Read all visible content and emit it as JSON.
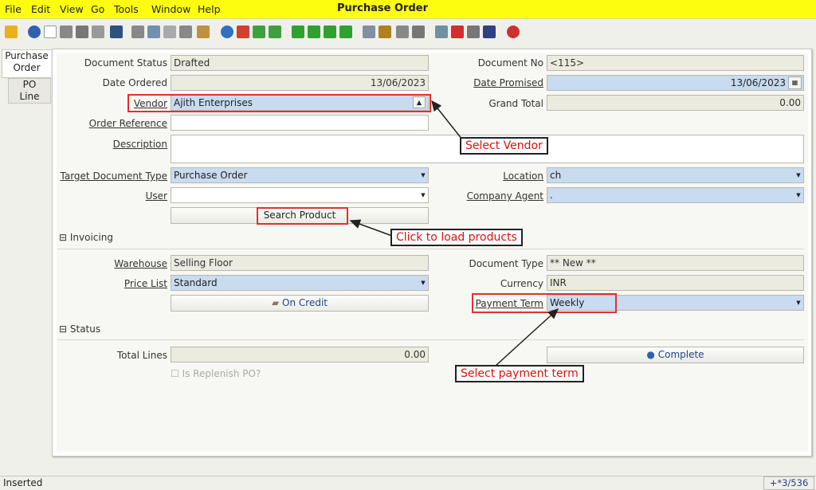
{
  "menu": {
    "file": "File",
    "edit": "Edit",
    "view": "View",
    "go": "Go",
    "tools": "Tools",
    "window": "Window",
    "help": "Help",
    "title": "Purchase Order"
  },
  "tabs": {
    "t1a": "Purchase",
    "t1b": "Order",
    "t2a": "PO",
    "t2b": "Line"
  },
  "form": {
    "document_status_label": "Document Status",
    "document_status": "Drafted",
    "document_no_label": "Document No",
    "document_no": "<115>",
    "date_ordered_label": "Date Ordered",
    "date_ordered": "13/06/2023",
    "date_promised_label": "Date Promised",
    "date_promised": "13/06/2023",
    "vendor_label": "Vendor",
    "vendor": "Ajith Enterprises",
    "grand_total_label": "Grand Total",
    "grand_total": "0.00",
    "order_ref_label": "Order Reference",
    "order_ref": "",
    "description_label": "Description",
    "description": "",
    "target_doc_label": "Target Document Type",
    "target_doc": "Purchase Order",
    "location_label": "Location",
    "location": "ch",
    "user_label": "User",
    "user": "",
    "company_agent_label": "Company Agent",
    "company_agent": ".",
    "search_product": "Search Product"
  },
  "invoicing": {
    "section": "Invoicing",
    "warehouse_label": "Warehouse",
    "warehouse": "Selling Floor",
    "doc_type_label": "Document Type",
    "doc_type": "** New **",
    "price_list_label": "Price List",
    "price_list": "Standard",
    "currency_label": "Currency",
    "currency": "INR",
    "on_credit": "On Credit",
    "payment_term_label": "Payment Term",
    "payment_term": "Weekly"
  },
  "status": {
    "section": "Status",
    "total_lines_label": "Total Lines",
    "total_lines": "0.00",
    "complete": "Complete",
    "replenish_label": "Is Replenish PO?"
  },
  "callouts": {
    "vendor": "Select Vendor",
    "products": "Click to load products",
    "payment": "Select payment term"
  },
  "statusbar": {
    "text": "Inserted",
    "record": "+*3/536"
  },
  "colors": {
    "menubar": "#fdfd0f",
    "mandatory": "#c9dbee",
    "readonly": "#ebebdf",
    "callout_text": "#e01010"
  }
}
